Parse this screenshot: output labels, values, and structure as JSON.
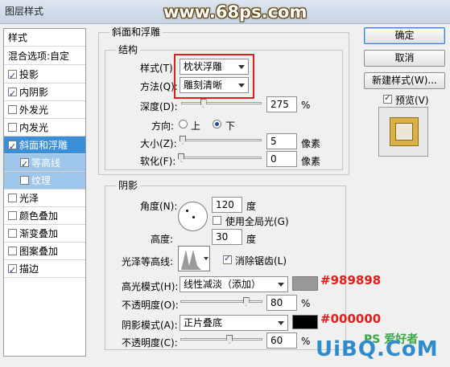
{
  "window": {
    "title": "图层样式"
  },
  "watermarks": {
    "top": "www.68ps.com",
    "bottom": "UiBQ.CoM",
    "ps_logo": "PS 爱好者"
  },
  "left_panel": {
    "header": "样式",
    "blend_options": "混合选项:自定",
    "items": [
      {
        "label": "投影",
        "checked": true
      },
      {
        "label": "内阴影",
        "checked": true
      },
      {
        "label": "外发光",
        "checked": false
      },
      {
        "label": "内发光",
        "checked": false
      },
      {
        "label": "斜面和浮雕",
        "checked": true,
        "selected": true
      },
      {
        "label": "等高线",
        "checked": true,
        "sub": true
      },
      {
        "label": "纹理",
        "checked": false,
        "sub": true
      },
      {
        "label": "光泽",
        "checked": false
      },
      {
        "label": "颜色叠加",
        "checked": false
      },
      {
        "label": "渐变叠加",
        "checked": false
      },
      {
        "label": "图案叠加",
        "checked": false
      },
      {
        "label": "描边",
        "checked": true
      }
    ]
  },
  "bevel": {
    "group_title": "斜面和浮雕",
    "structure_title": "结构",
    "style_label": "样式(T):",
    "style_value": "枕状浮雕",
    "technique_label": "方法(Q):",
    "technique_value": "雕刻清晰",
    "depth_label": "深度(D):",
    "depth_value": "275",
    "depth_unit": "%",
    "depth_level": 0.275,
    "direction_label": "方向:",
    "direction_up": "上",
    "direction_down": "下",
    "direction_selected": "下",
    "size_label": "大小(Z):",
    "size_value": "5",
    "size_unit": "像素",
    "size_level": 0.02,
    "soften_label": "软化(F):",
    "soften_value": "0",
    "soften_unit": "像素",
    "soften_level": 0
  },
  "shading": {
    "group_title": "阴影",
    "angle_label": "角度(N):",
    "angle_value": "120",
    "angle_unit": "度",
    "global_light_label": "使用全局光(G)",
    "global_light_checked": false,
    "altitude_label": "高度:",
    "altitude_value": "30",
    "altitude_unit": "度",
    "gloss_contour_label": "光泽等高线:",
    "anti_alias_label": "消除锯齿(L)",
    "anti_alias_checked": true,
    "highlight_mode_label": "高光模式(H):",
    "highlight_mode_value": "线性减淡（添加）",
    "highlight_color": "#989898",
    "highlight_annotation": "#989898",
    "highlight_opacity_label": "不透明度(O):",
    "highlight_opacity_value": "80",
    "highlight_opacity_level": 0.8,
    "shadow_mode_label": "阴影模式(A):",
    "shadow_mode_value": "正片叠底",
    "shadow_color": "#000000",
    "shadow_annotation": "#000000",
    "shadow_opacity_label": "不透明度(C):",
    "shadow_opacity_value": "60",
    "shadow_opacity_level": 0.6,
    "percent": "%"
  },
  "buttons": {
    "ok": "确定",
    "cancel": "取消",
    "new_style": "新建样式(W)...",
    "preview_label": "预览(V)",
    "preview_checked": true
  },
  "colors": {
    "selected_bg": "#3b8fd9",
    "sub_bg": "#9ec6ea",
    "annotation_red": "#e0201a",
    "preview_gold": "#d8b247"
  }
}
